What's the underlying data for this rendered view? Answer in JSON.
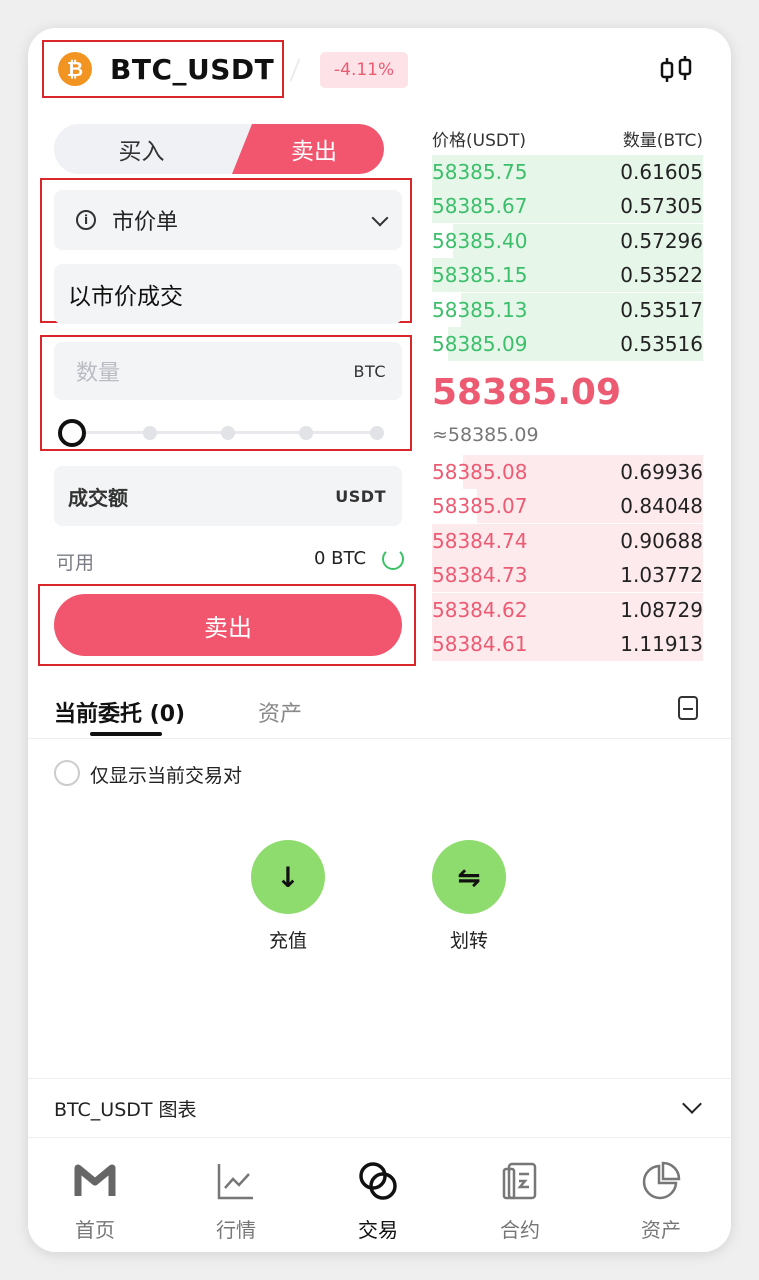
{
  "header": {
    "pair": "BTC_USDT",
    "coin_glyph": "₿",
    "change": "-4.11%",
    "accent_color": "#f2566f"
  },
  "trade": {
    "buy_label": "买入",
    "sell_label": "卖出",
    "order_type": "市价单",
    "market_text": "以市价成交",
    "qty_placeholder": "数量",
    "qty_unit": "BTC",
    "amount_label": "成交额",
    "amount_unit": "USDT",
    "available_label": "可用",
    "available_value": "0 BTC",
    "submit_label": "卖出"
  },
  "orderbook": {
    "price_header": "价格(USDT)",
    "amount_header": "数量(BTC)",
    "asks": [
      {
        "price": "58385.75",
        "amount": "0.61605"
      },
      {
        "price": "58385.67",
        "amount": "0.57305"
      },
      {
        "price": "58385.40",
        "amount": "0.57296"
      },
      {
        "price": "58385.15",
        "amount": "0.53522"
      },
      {
        "price": "58385.13",
        "amount": "0.53517"
      },
      {
        "price": "58385.09",
        "amount": "0.53516"
      }
    ],
    "last_price": "58385.09",
    "last_price_approx": "≈58385.09",
    "bids": [
      {
        "price": "58385.08",
        "amount": "0.69936"
      },
      {
        "price": "58385.07",
        "amount": "0.84048"
      },
      {
        "price": "58384.74",
        "amount": "0.90688"
      },
      {
        "price": "58384.73",
        "amount": "1.03772"
      },
      {
        "price": "58384.62",
        "amount": "1.08729"
      },
      {
        "price": "58384.61",
        "amount": "1.11913"
      }
    ]
  },
  "orders": {
    "tab_current": "当前委托 (0)",
    "tab_assets": "资产",
    "filter_label": "仅显示当前交易对",
    "deposit_label": "充值",
    "transfer_label": "划转"
  },
  "chart_toggle": "BTC_USDT 图表",
  "nav": [
    {
      "label": "首页",
      "icon": "home-m-icon"
    },
    {
      "label": "行情",
      "icon": "market-chart-icon"
    },
    {
      "label": "交易",
      "icon": "trade-icon"
    },
    {
      "label": "合约",
      "icon": "contract-icon"
    },
    {
      "label": "资产",
      "icon": "pie-chart-icon"
    }
  ]
}
